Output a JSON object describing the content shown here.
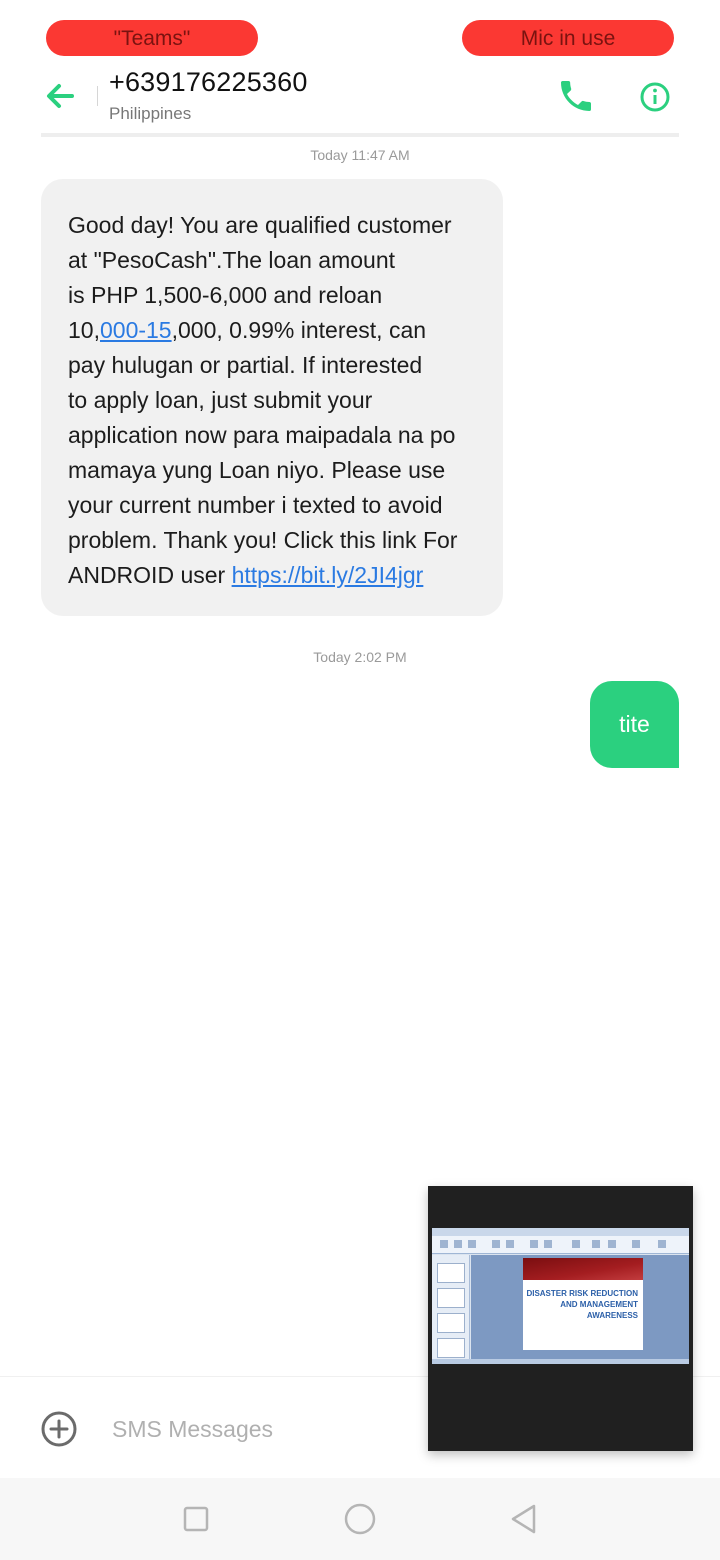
{
  "status_pills": {
    "left": "\"Teams\"",
    "right": "Mic in use"
  },
  "header": {
    "back_icon": "back-arrow-icon",
    "contact_number": "+639176225360",
    "contact_country": "Philippines",
    "call_icon": "phone-icon",
    "info_icon": "info-icon"
  },
  "conversation": {
    "timestamp_1": "Today 11:47 AM",
    "incoming_message": {
      "line_1": "Good day! You are qualified customer",
      "line_2": "at \"PesoCash\".The loan amount",
      "line_3": "is PHP 1,500-6,000 and reloan",
      "line_4_pre": "10,",
      "line_4_link": "000-15",
      "line_4_post": ",000, 0.99% interest, can",
      "line_5": "pay hulugan or partial. If interested",
      "line_6": "to apply loan, just submit your",
      "line_7": "application now para maipadala na po",
      "line_8": "mamaya yung Loan niyo. Please use",
      "line_9": "your current number i texted to avoid",
      "line_10": "problem. Thank you! Click this link For",
      "line_11_pre": "ANDROID user ",
      "line_11_link": "https://bit.ly/2JI4jgr"
    },
    "timestamp_2": "Today 2:02 PM",
    "outgoing_message": "tite"
  },
  "composer": {
    "add_icon": "add-circle-icon",
    "placeholder": "SMS Messages"
  },
  "pip_window": {
    "slide_title": "DISASTER RISK REDUCTION AND MANAGEMENT AWARENESS"
  },
  "navbar": {
    "recent_icon": "square-recent-apps-icon",
    "home_icon": "circle-home-icon",
    "back_icon": "triangle-back-icon"
  },
  "colors": {
    "accent_green": "#2bd07f",
    "pill_red": "#fb3833",
    "link_blue": "#2a7ae2"
  }
}
